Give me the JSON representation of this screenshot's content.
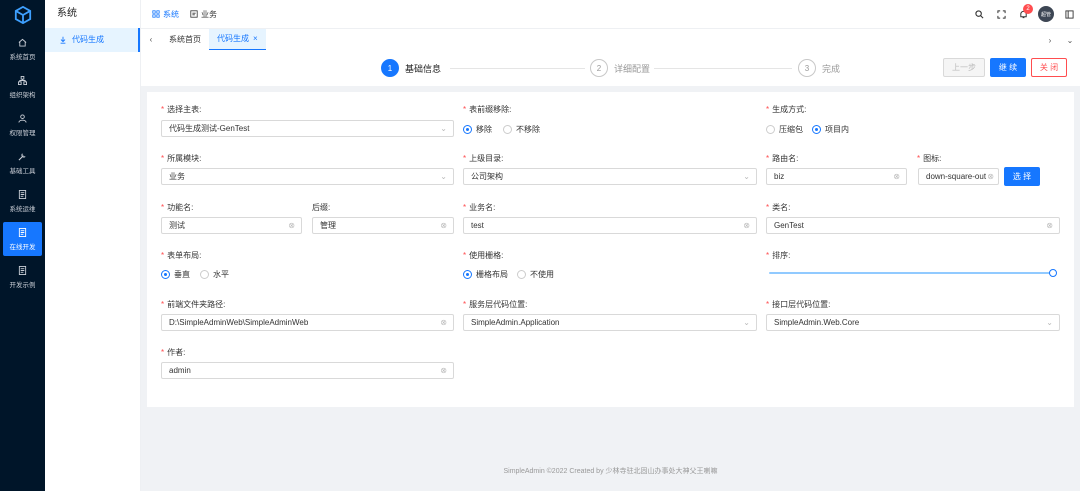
{
  "sidebar": {
    "items": [
      {
        "label": "系统首页",
        "icon": "home-icon"
      },
      {
        "label": "组织架构",
        "icon": "org-icon"
      },
      {
        "label": "权限管理",
        "icon": "user-icon"
      },
      {
        "label": "基础工具",
        "icon": "tool-icon"
      },
      {
        "label": "系统运维",
        "icon": "ops-icon"
      },
      {
        "label": "在线开发",
        "icon": "dev-icon",
        "active": true
      },
      {
        "label": "开发示例",
        "icon": "example-icon"
      }
    ]
  },
  "submenu": {
    "title": "系统",
    "item": "代码生成"
  },
  "header": {
    "modules": [
      {
        "label": "系统"
      },
      {
        "label": "业务"
      }
    ],
    "badge": "2",
    "avatar": "超管"
  },
  "tabs": [
    {
      "label": "系统首页"
    },
    {
      "label": "代码生成",
      "close": "×"
    }
  ],
  "steps": [
    {
      "num": "1",
      "label": "基础信息"
    },
    {
      "num": "2",
      "label": "详细配置"
    },
    {
      "num": "3",
      "label": "完成"
    }
  ],
  "buttons": {
    "prev": "上一步",
    "next": "继 续",
    "close": "关 闭"
  },
  "form": {
    "main_table": {
      "label": "选择主表:",
      "value": "代码生成测试-GenTest"
    },
    "prefix": {
      "label": "表前缀移除:",
      "opt1": "移除",
      "opt2": "不移除"
    },
    "gen_mode": {
      "label": "生成方式:",
      "opt1": "压缩包",
      "opt2": "项目内"
    },
    "module": {
      "label": "所属模块:",
      "value": "业务"
    },
    "parent": {
      "label": "上级目录:",
      "value": "公司架构"
    },
    "route": {
      "label": "路由名:",
      "value": "biz"
    },
    "icon": {
      "label": "图标:",
      "value": "down-square-out",
      "btn": "选 择"
    },
    "func": {
      "label": "功能名:",
      "value": "测试"
    },
    "suffix": {
      "label": "后缀:",
      "value": "管理"
    },
    "biz": {
      "label": "业务名:",
      "value": "test"
    },
    "cls": {
      "label": "类名:",
      "value": "GenTest"
    },
    "layout": {
      "label": "表单布局:",
      "opt1": "垂直",
      "opt2": "水平"
    },
    "grid": {
      "label": "使用栅格:",
      "opt1": "栅格布局",
      "opt2": "不使用"
    },
    "sort": {
      "label": "排序:",
      "value": 1.0
    },
    "front": {
      "label": "前端文件夹路径:",
      "value": "D:\\SimpleAdminWeb\\SimpleAdminWeb"
    },
    "service": {
      "label": "服务层代码位置:",
      "value": "SimpleAdmin.Application"
    },
    "api": {
      "label": "接口层代码位置:",
      "value": "SimpleAdmin.Web.Core"
    },
    "author": {
      "label": "作者:",
      "value": "admin"
    }
  },
  "footer": "SimpleAdmin ©2022 Created by 少林寺驻北固山办事处大神父王喇嘛",
  "colors": {
    "primary": "#1677ff",
    "sidebar": "#001529",
    "danger": "#ff4d4f"
  }
}
